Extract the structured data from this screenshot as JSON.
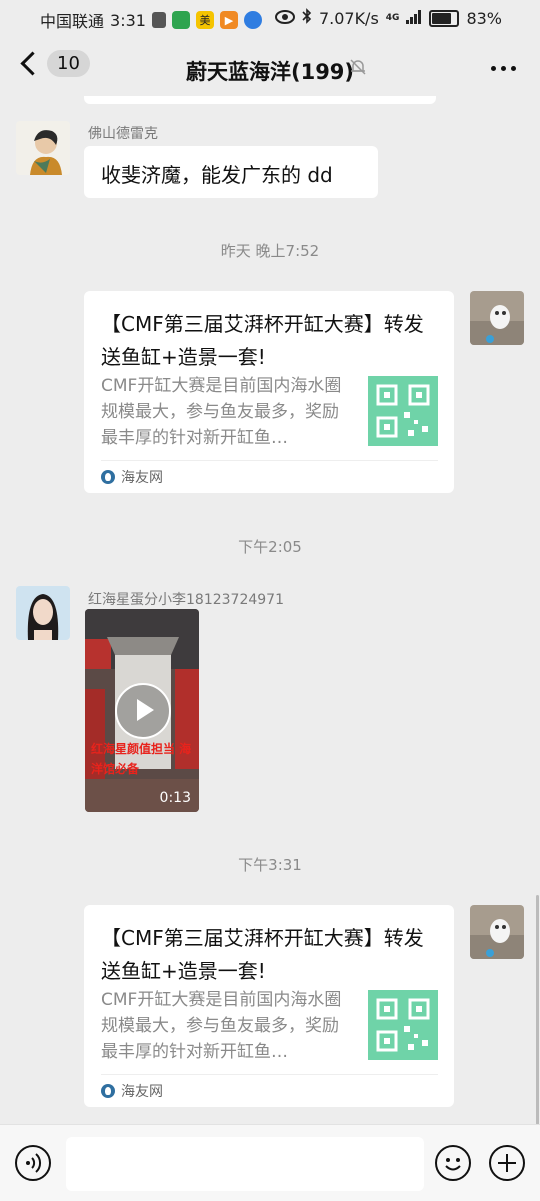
{
  "status_bar": {
    "carrier": "中国联通",
    "time": "3:31",
    "speed": "7.07K/s",
    "network": "4G",
    "battery": "83%",
    "battery_level": 0.83
  },
  "header": {
    "unread_count": "10",
    "title": "蔚天蓝海洋(199)"
  },
  "messages": [
    {
      "sender": "佛山德雷克",
      "text": "收斐济魔，能发广东的 dd"
    },
    {
      "timestamp": "昨天 晚上7:52"
    },
    {
      "card_title": "【CMF第三届艾湃杯开缸大赛】转发送鱼缸+造景一套!",
      "card_desc": "CMF开缸大赛是目前国内海水圈规模最大，参与鱼友最多，奖励最丰厚的针对新开缸鱼…",
      "card_source": "海友网"
    },
    {
      "timestamp": "下午2:05"
    },
    {
      "sender": "红海星蛋分小李18123724971",
      "video_caption": "红海星颜值担当 海洋馆必备",
      "video_duration": "0:13"
    },
    {
      "timestamp": "下午3:31"
    },
    {
      "card_title": "【CMF第三届艾湃杯开缸大赛】转发送鱼缸+造景一套!",
      "card_desc": "CMF开缸大赛是目前国内海水圈规模最大，参与鱼友最多，奖励最丰厚的针对新开缸鱼…",
      "card_source": "海友网"
    }
  ],
  "colors": {
    "background": "#ededed",
    "bubble": "#ffffff",
    "timestamp": "#8a8a8a",
    "thumbnail_qr": "#6fd3a8"
  }
}
